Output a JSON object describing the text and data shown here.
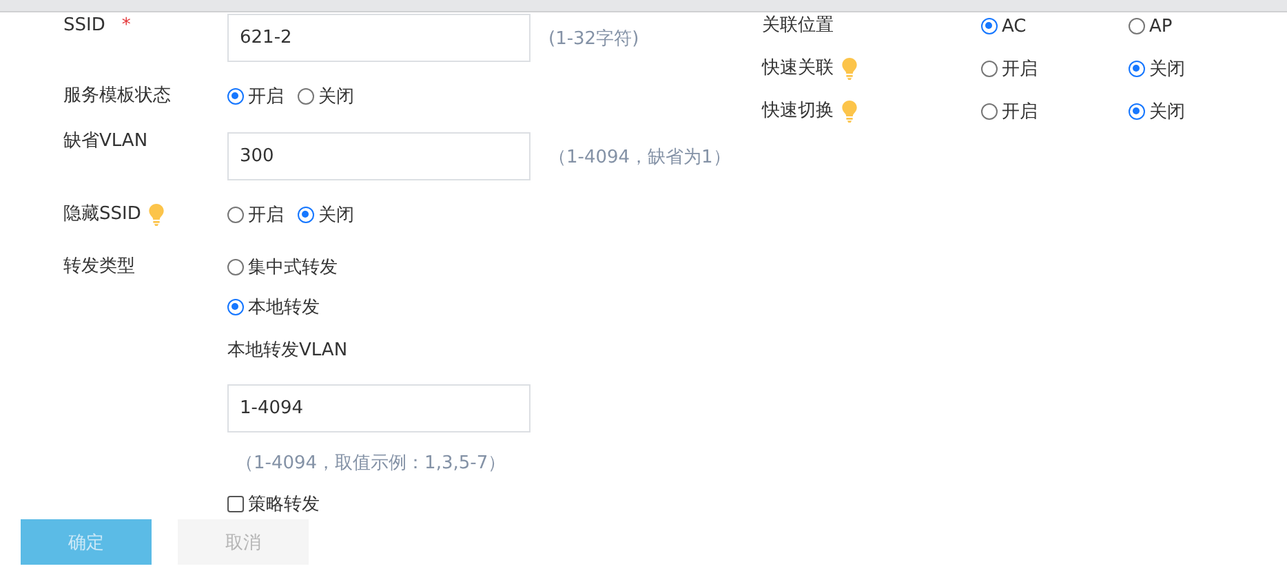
{
  "left_fields": [
    {
      "kind": "text",
      "label": "SSID",
      "required_mark": "*",
      "value": "621-2",
      "hint": "(1-32字符)"
    },
    {
      "kind": "radio",
      "label": "服务模板状态",
      "options": [
        {
          "label": "开启",
          "selected": true
        },
        {
          "label": "关闭",
          "selected": false
        }
      ]
    },
    {
      "kind": "text",
      "label": "缺省VLAN",
      "value": "300",
      "hint": "（1-4094，缺省为1）"
    },
    {
      "kind": "radio",
      "label": "隐藏SSID",
      "tip": true,
      "options": [
        {
          "label": "开启",
          "selected": false
        },
        {
          "label": "关闭",
          "selected": true
        }
      ]
    },
    {
      "kind": "stacked",
      "label": "转发类型",
      "options": [
        {
          "label": "集中式转发",
          "selected": false
        },
        {
          "label": "本地转发",
          "selected": true
        }
      ],
      "sub_label": "本地转发VLAN",
      "sub_value": "1-4094",
      "sub_hint": "（1-4094，取值示例：1,3,5-7）",
      "checkbox": {
        "label": "策略转发",
        "checked": false
      }
    }
  ],
  "right_fields": [
    {
      "label": "关联位置",
      "options": [
        {
          "label": "AC",
          "selected": true
        },
        {
          "label": "AP",
          "selected": false
        }
      ]
    },
    {
      "label": "快速关联",
      "tip": true,
      "options": [
        {
          "label": "开启",
          "selected": false
        },
        {
          "label": "关闭",
          "selected": true
        }
      ]
    },
    {
      "label": "快速切换",
      "tip": true,
      "options": [
        {
          "label": "开启",
          "selected": false
        },
        {
          "label": "关闭",
          "selected": true
        }
      ]
    }
  ],
  "buttons": [
    {
      "label": "确定",
      "kind": "primary",
      "disabled": true
    },
    {
      "label": "取消",
      "kind": "default",
      "disabled": true
    }
  ]
}
